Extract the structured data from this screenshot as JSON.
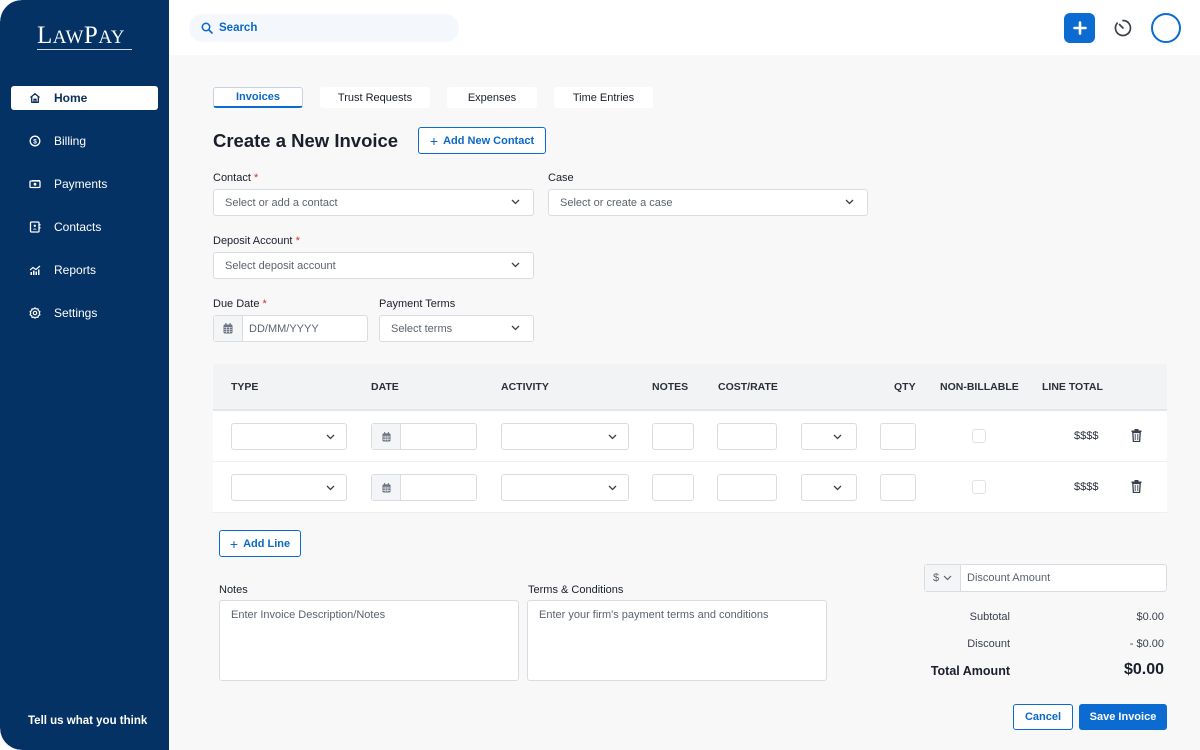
{
  "brand": {
    "logo_first": "L",
    "logo_mid": "AW",
    "logo_p": "P",
    "logo_end": "AY"
  },
  "sidebar": {
    "items": [
      {
        "label": "Home",
        "icon": "home-icon",
        "active": true
      },
      {
        "label": "Billing",
        "icon": "dollar-circle-icon"
      },
      {
        "label": "Payments",
        "icon": "money-icon"
      },
      {
        "label": "Contacts",
        "icon": "contact-book-icon"
      },
      {
        "label": "Reports",
        "icon": "chart-icon"
      },
      {
        "label": "Settings",
        "icon": "gear-icon"
      }
    ],
    "feedback": "Tell us what you think"
  },
  "topbar": {
    "search_placeholder": "Search"
  },
  "tabs": [
    {
      "label": "Invoices",
      "active": true
    },
    {
      "label": "Trust Requests"
    },
    {
      "label": "Expenses"
    },
    {
      "label": "Time Entries"
    }
  ],
  "page": {
    "title": "Create a New Invoice",
    "add_contact": "Add New Contact"
  },
  "form": {
    "contact": {
      "label": "Contact",
      "placeholder": "Select or add a contact",
      "required": "*"
    },
    "case": {
      "label": "Case",
      "placeholder": "Select or create a case"
    },
    "deposit": {
      "label": "Deposit Account",
      "placeholder": "Select deposit account",
      "required": "*"
    },
    "due_date": {
      "label": "Due Date",
      "placeholder": "DD/MM/YYYY",
      "required": "*"
    },
    "terms": {
      "label": "Payment Terms",
      "placeholder": "Select terms"
    }
  },
  "table": {
    "headers": [
      "TYPE",
      "DATE",
      "ACTIVITY",
      "NOTES",
      "COST/RATE",
      "QTY",
      "NON-BILLABLE",
      "LINE TOTAL"
    ],
    "rows": [
      {
        "line_total": "$$$$"
      },
      {
        "line_total": "$$$$"
      }
    ],
    "add_line": "Add Line"
  },
  "notes": {
    "label": "Notes",
    "placeholder": "Enter Invoice Description/Notes"
  },
  "tnc": {
    "label": "Terms & Conditions",
    "placeholder": "Enter your firm's payment terms and conditions"
  },
  "summary": {
    "currency": "$",
    "discount_placeholder": "Discount Amount",
    "subtotal_label": "Subtotal",
    "subtotal": "$0.00",
    "discount_label": "Discount",
    "discount": "- $0.00",
    "total_label": "Total Amount",
    "total": "$0.00"
  },
  "actions": {
    "cancel": "Cancel",
    "save": "Save Invoice"
  },
  "colors": {
    "sidebar": "#043264",
    "accent": "#0b6bd1",
    "required": "#d0302c"
  }
}
